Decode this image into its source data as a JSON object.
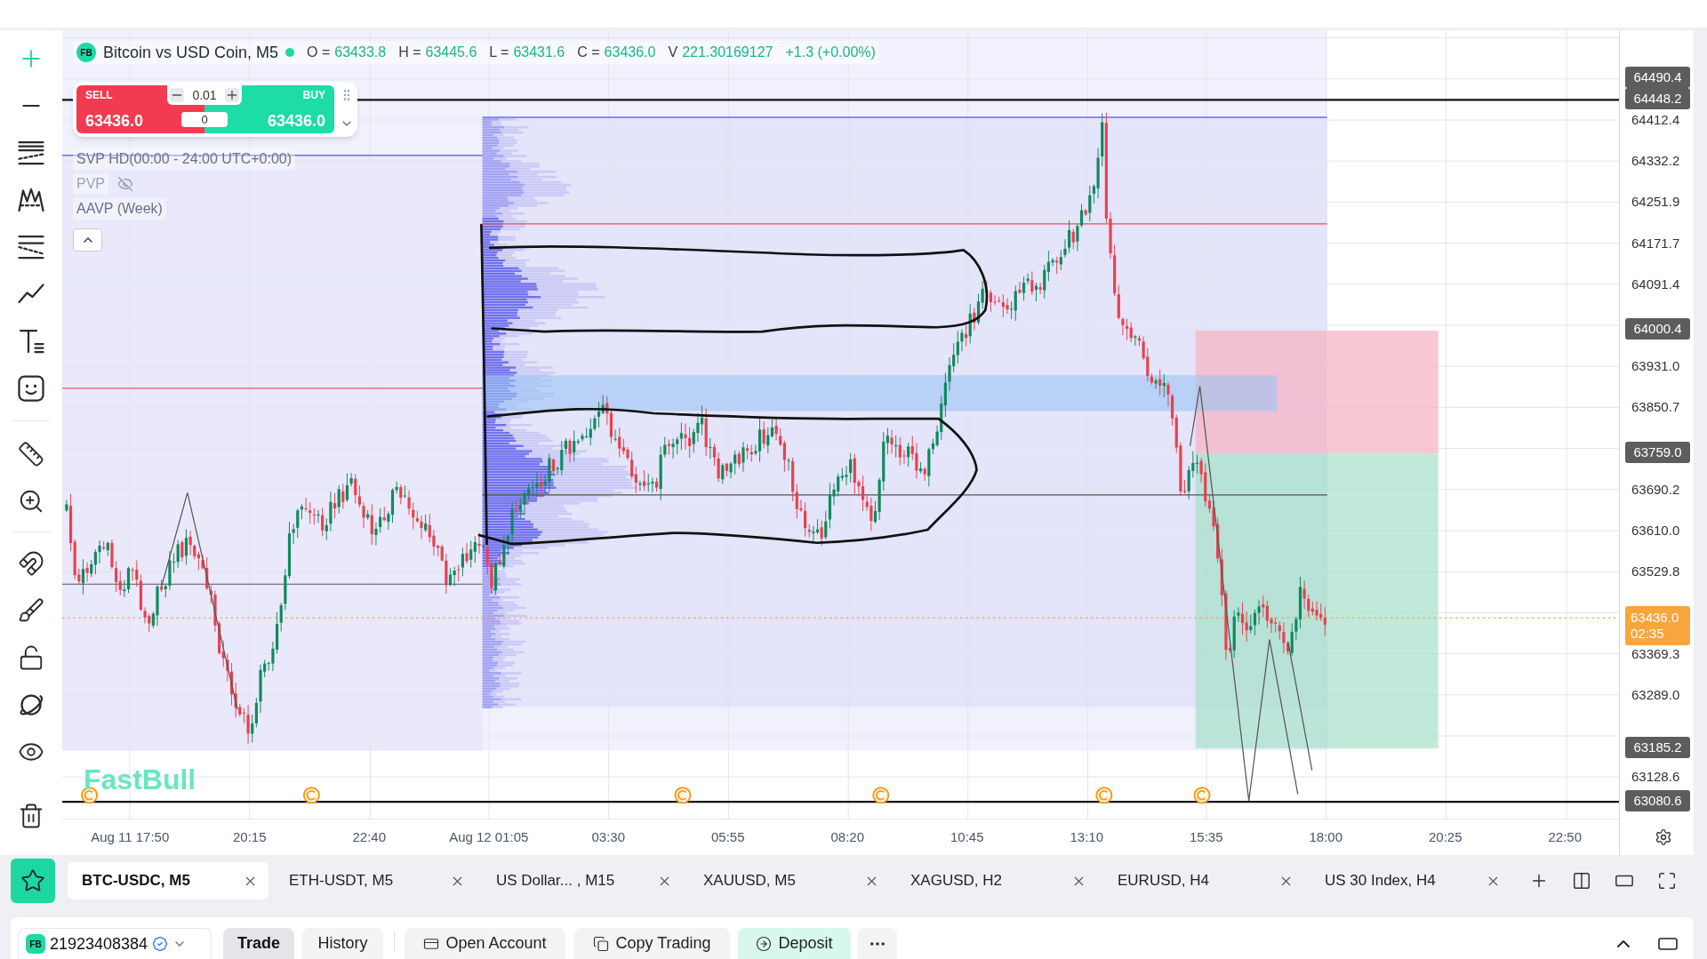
{
  "drawing_tools": [
    {
      "selected": true
    },
    {
      "selected": false
    },
    {
      "selected": false
    },
    {
      "selected": false
    },
    {
      "selected": false
    },
    {
      "selected": false
    },
    {
      "selected": false
    },
    {
      "selected": false
    },
    {
      "selected": false
    },
    {
      "selected": false
    },
    {
      "selected": false
    },
    {
      "selected": false
    },
    {
      "selected": false
    },
    {
      "selected": false
    },
    {
      "selected": false
    },
    {
      "selected": false
    }
  ],
  "legend": {
    "symbol_badge": "FB",
    "title": "Bitcoin vs USD Coin, M5",
    "market_open": true,
    "ohlc": [
      {
        "label": "O =",
        "value": "63433.8"
      },
      {
        "label": "H =",
        "value": "63445.6"
      },
      {
        "label": "L =",
        "value": "63431.6"
      },
      {
        "label": "C =",
        "value": "63436.0"
      },
      {
        "label": "V",
        "value": "221.30169127"
      }
    ],
    "change": "+1.3 (+0.00%)"
  },
  "trade_panel": {
    "sell_label": "SELL",
    "sell_price": "63436.0",
    "buy_label": "BUY",
    "buy_price": "63436.0",
    "lot_size": "0.01",
    "spread": "0"
  },
  "indicators": [
    {
      "name": "SVP HD(00:00 - 24:00 UTC+0:00)",
      "hidden": false
    },
    {
      "name": "PVP",
      "hidden": true
    },
    {
      "name": "AAVP (Week)",
      "hidden": false
    }
  ],
  "indicators_expanded": true,
  "chart_logo": "FastBull",
  "price_axis": {
    "labels": [
      "64412.4",
      "64332.2",
      "64251.9",
      "64171.7",
      "64091.4",
      "63931.0",
      "63850.7",
      "63690.2",
      "63610.0",
      "63529.8",
      "63369.3",
      "63289.0",
      "63128.6"
    ],
    "tags": [
      {
        "kind": "marker",
        "text": "64490.4"
      },
      {
        "kind": "marker",
        "text": "64448.2"
      },
      {
        "kind": "marker",
        "text": "64000.4"
      },
      {
        "kind": "marker",
        "text": "63759.0"
      },
      {
        "kind": "last_price",
        "text": "63436.0",
        "countdown": "02:35"
      },
      {
        "kind": "marker",
        "text": "63185.2"
      },
      {
        "kind": "marker",
        "text": "63080.6"
      }
    ]
  },
  "time_axis": {
    "labels": [
      "Aug 11 17:50",
      "20:15",
      "22:40",
      "Aug 12 01:05",
      "03:30",
      "05:55",
      "08:20",
      "10:45",
      "13:10",
      "15:35",
      "18:00",
      "20:25",
      "22:50"
    ]
  },
  "chart_tabs": [
    {
      "label": "BTC-USDC, M5",
      "selected": true
    },
    {
      "label": "ETH-USDT, M5",
      "selected": false
    },
    {
      "label": "US Dollar... , M15",
      "selected": false
    },
    {
      "label": "XAUUSD, M5",
      "selected": false
    },
    {
      "label": "XAGUSD, H2",
      "selected": false
    },
    {
      "label": "EURUSD, H4",
      "selected": false
    },
    {
      "label": "US 30 Index, H4",
      "selected": false
    }
  ],
  "account": {
    "badge": "FB",
    "number": "21923408384",
    "verified": true
  },
  "bottom_tabs": [
    {
      "label": "Trade",
      "selected": true
    },
    {
      "label": "History",
      "selected": false
    }
  ],
  "actions": [
    {
      "kind": "open_account",
      "label": "Open Account"
    },
    {
      "kind": "copy_trading",
      "label": "Copy Trading"
    },
    {
      "kind": "deposit",
      "label": "Deposit"
    }
  ]
}
